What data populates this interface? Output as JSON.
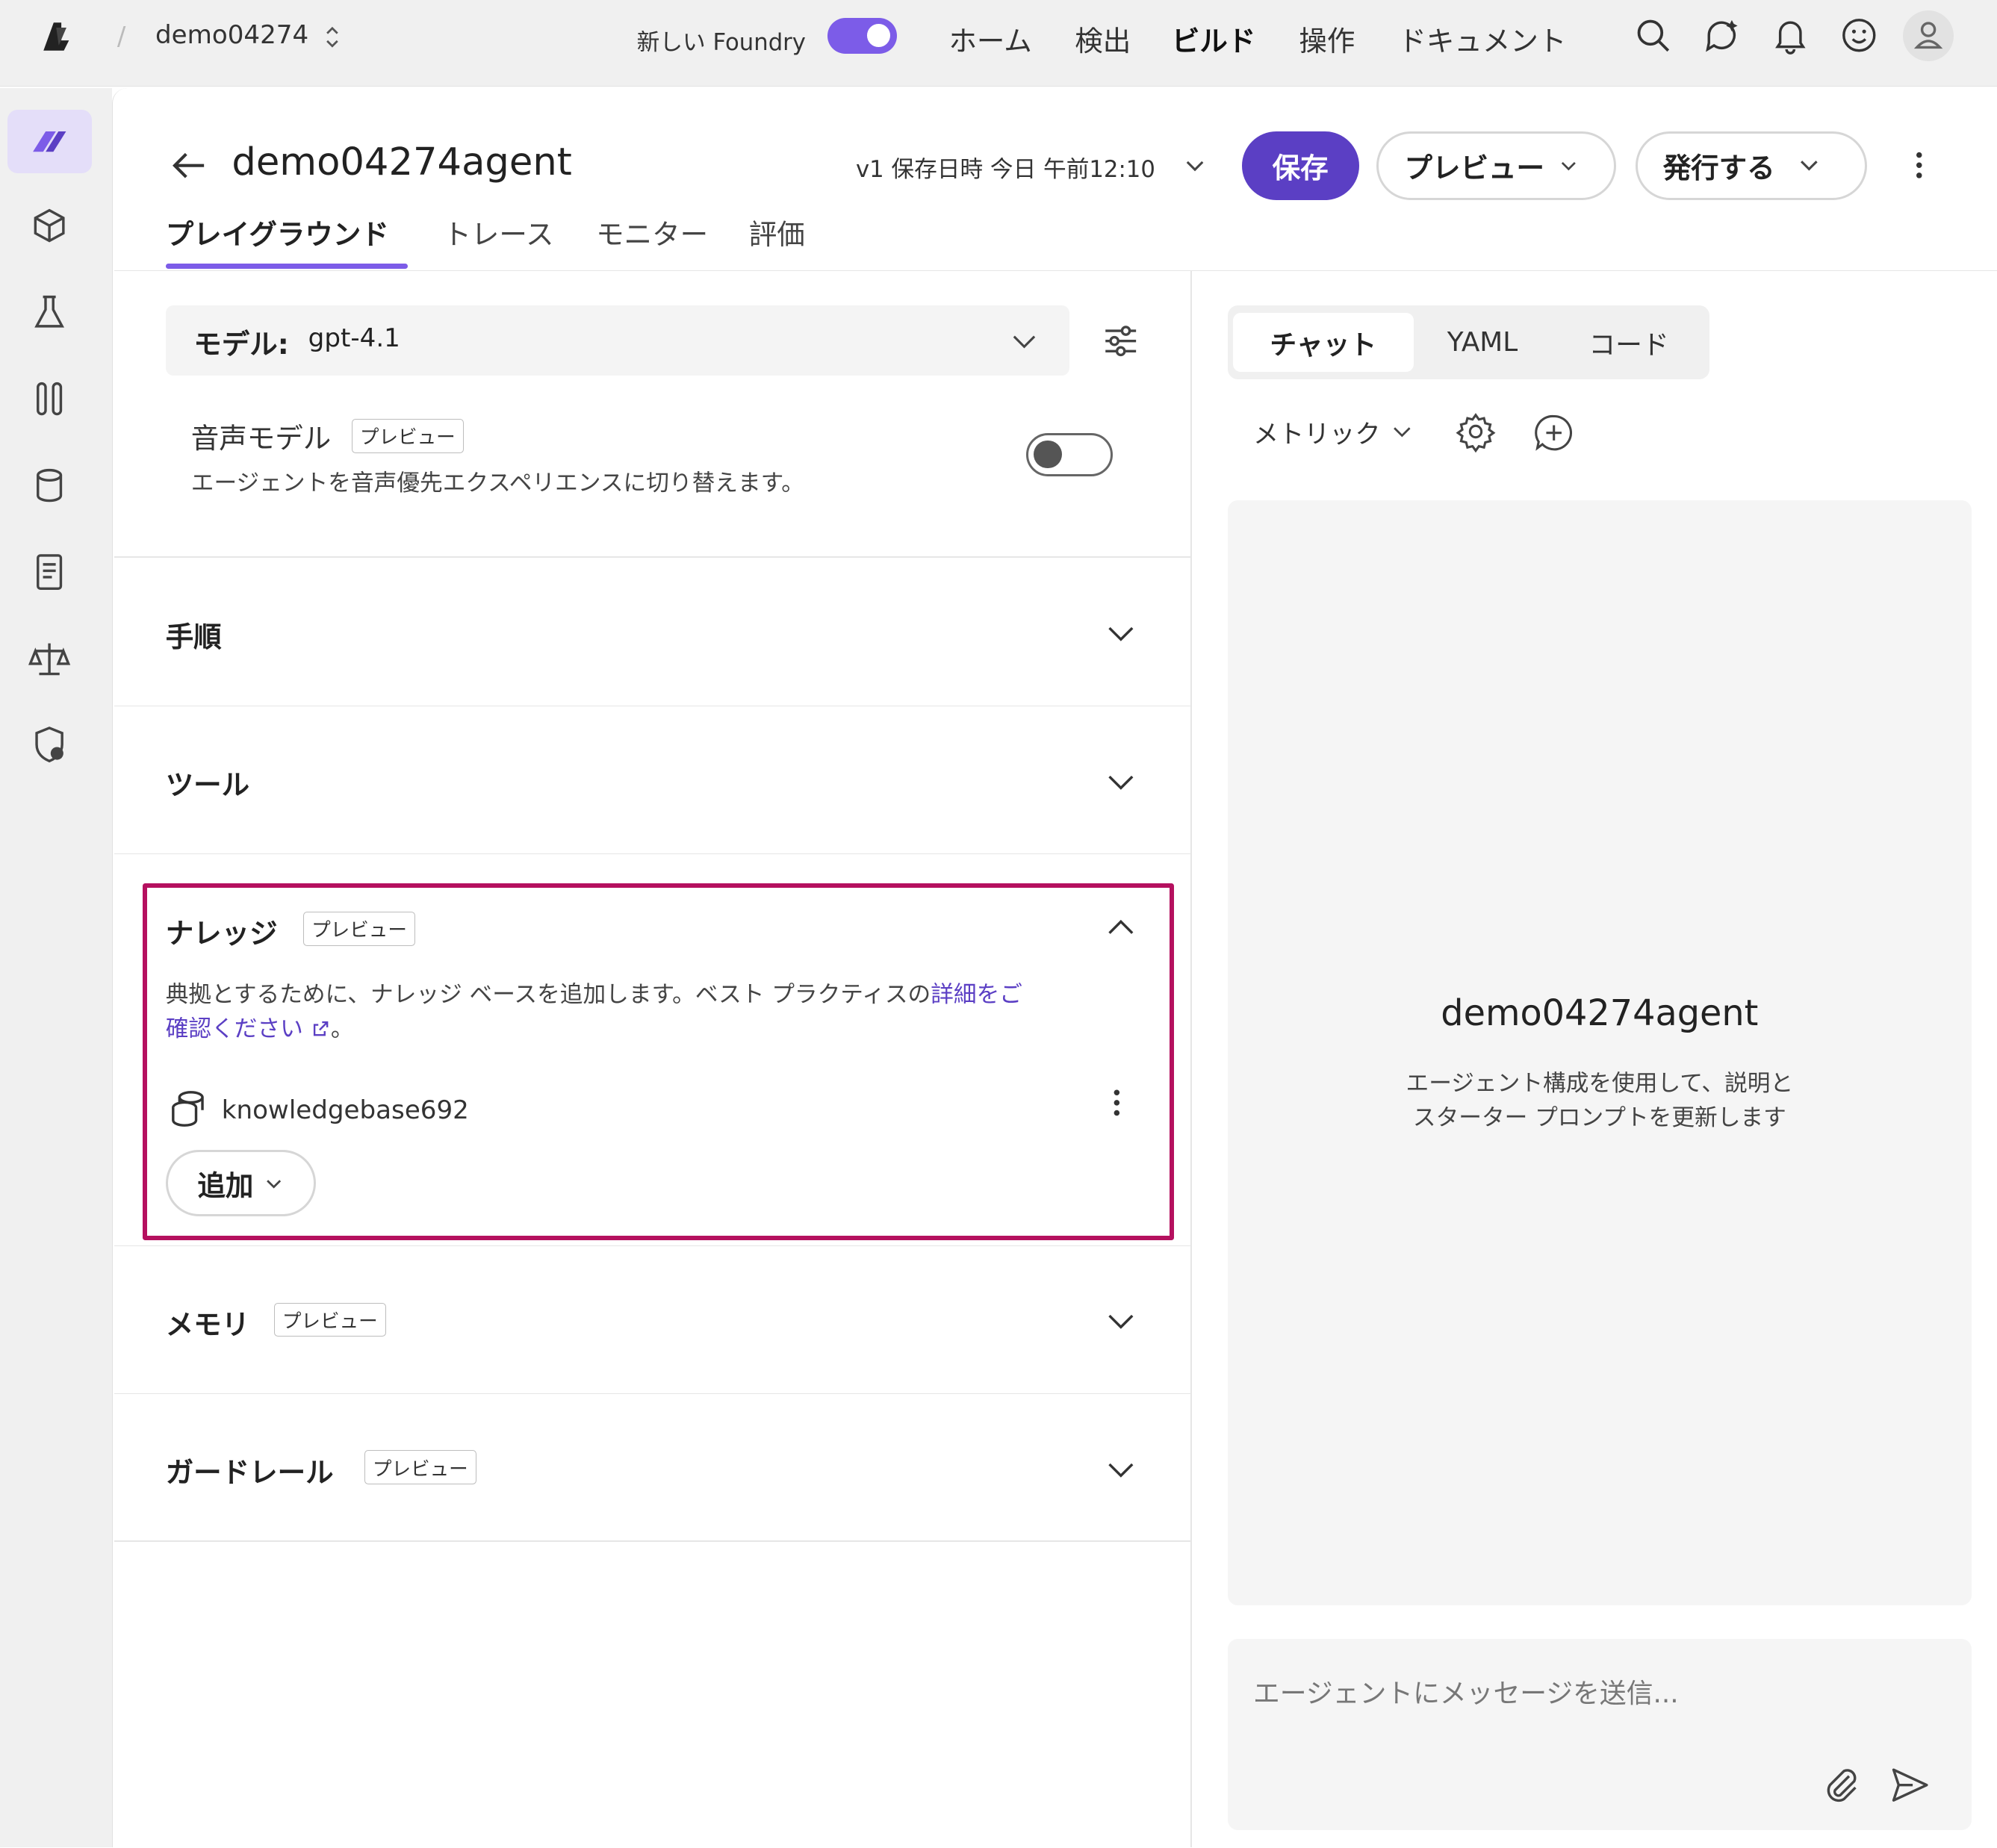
{
  "topbar": {
    "project": "demo04274",
    "new_foundry_label": "新しい Foundry",
    "nav": [
      "ホーム",
      "検出",
      "ビルド",
      "操作",
      "ドキュメント"
    ],
    "active_nav": "ビルド"
  },
  "header": {
    "agent_title": "demo04274agent",
    "version": "v1 保存日時 今日 午前12:10",
    "save_label": "保存",
    "preview_label": "プレビュー",
    "publish_label": "発行する",
    "tabs": [
      "プレイグラウンド",
      "トレース",
      "モニター",
      "評価"
    ],
    "active_tab": "プレイグラウンド"
  },
  "config": {
    "model_label": "モデル:",
    "model_value": "gpt-4.1",
    "voice_title": "音声モデル",
    "preview_badge": "プレビュー",
    "voice_desc": "エージェントを音声優先エクスペリエンスに切り替えます。",
    "voice_enabled": false,
    "sections": {
      "instructions": "手順",
      "tools": "ツール",
      "knowledge": "ナレッジ",
      "memory": "メモリ",
      "guardrails": "ガードレール"
    },
    "knowledge": {
      "desc_prefix": "典拠とするために、ナレッジ ベースを追加します。ベスト プラクティスの",
      "link_line1": "詳細をご",
      "link_line2": "確認ください",
      "desc_suffix": "。",
      "item_name": "knowledgebase692",
      "add_label": "追加"
    }
  },
  "chat": {
    "tabs": [
      "チャット",
      "YAML",
      "コード"
    ],
    "active_tab": "チャット",
    "metrics_label": "メトリック",
    "title": "demo04274agent",
    "desc_line1": "エージェント構成を使用して、説明と",
    "desc_line2": "スターター プロンプトを更新します",
    "input_placeholder": "エージェントにメッセージを送信..."
  },
  "colors": {
    "accent": "#5b3fc4",
    "toggle_on": "#7c5ce8",
    "highlight": "#b5105f"
  }
}
